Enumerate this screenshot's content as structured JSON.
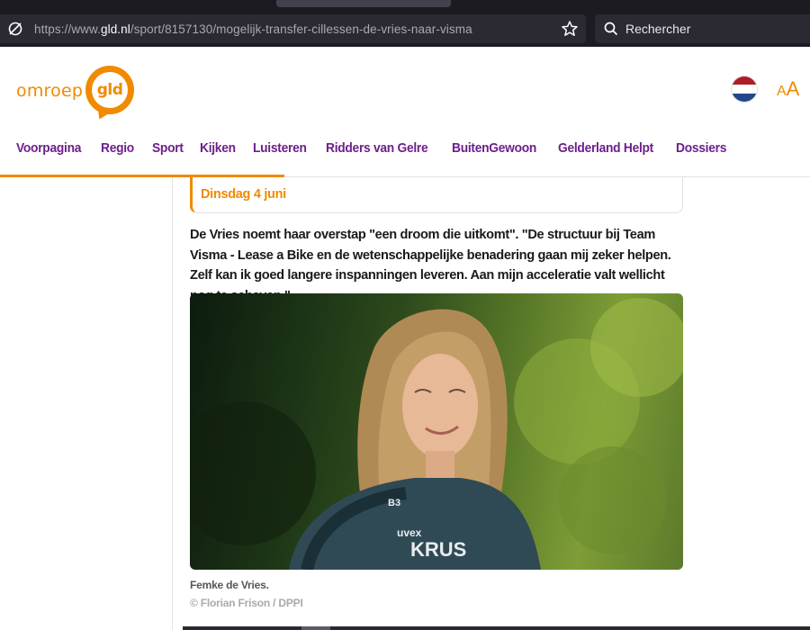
{
  "browser": {
    "url_prefix": "https://www.",
    "url_domain": "gld.nl",
    "url_path": "/sport/8157130/mogelijk-transfer-cillessen-de-vries-naar-visma",
    "search_placeholder": "Rechercher"
  },
  "site": {
    "logo_word": "omroep",
    "logo_mark": "gld",
    "font_toggle_small": "A",
    "font_toggle_large": "A",
    "nav": [
      "Voorpagina",
      "Regio",
      "Sport",
      "Kijken",
      "Luisteren",
      "Ridders van Gelre",
      "BuitenGewoon",
      "Gelderland Helpt",
      "Dossiers"
    ]
  },
  "article": {
    "date": "Dinsdag 4 juni",
    "body": "De Vries noemt haar overstap \"een droom die uitkomt\". \"De structuur bij Team Visma - Lease a Bike en de wetenschappelijke benadering gaan mij zeker helpen. Zelf kan ik goed langere inspanningen leveren. Aan mijn acceleratie valt wellicht nog te schaven.\"",
    "caption": "Femke de Vries.",
    "credit": "© Florian Frison / DPPI"
  },
  "colors": {
    "brand_orange": "#f08a00",
    "nav_purple": "#6e1f8c",
    "browser_dark": "#1c1b22"
  }
}
